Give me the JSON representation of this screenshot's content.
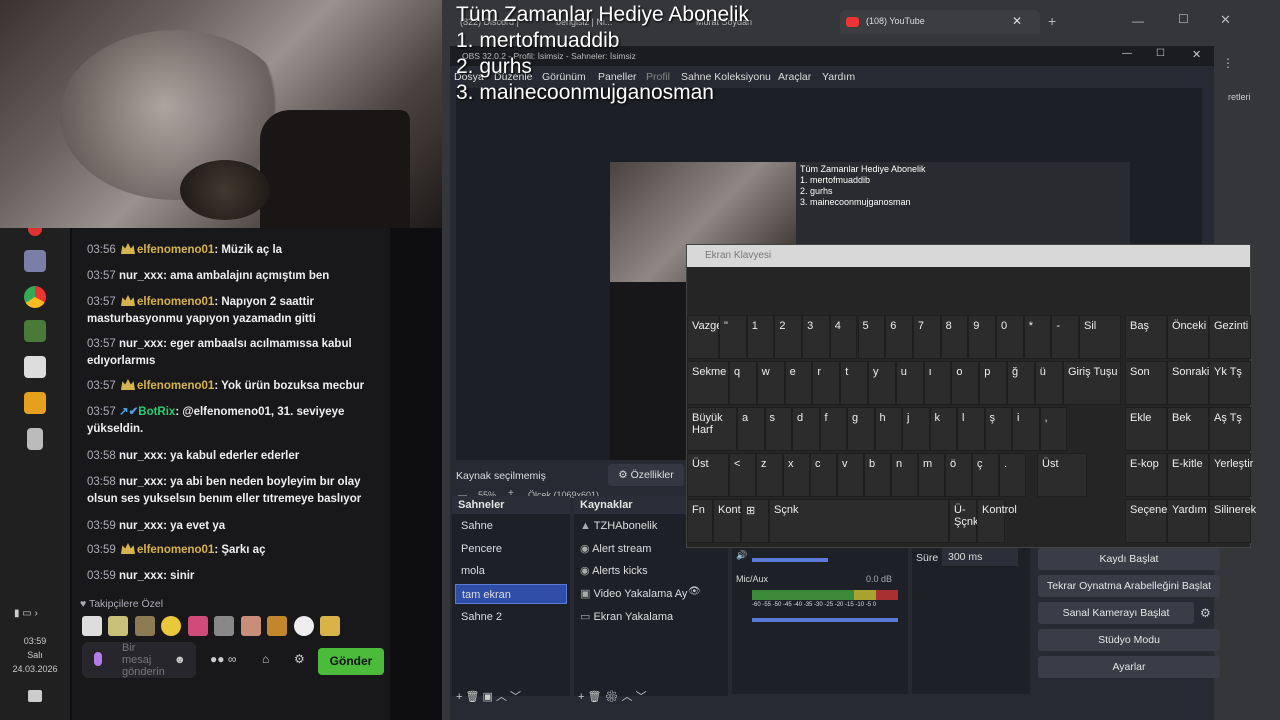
{
  "browser": {
    "tabs": [
      {
        "label": "(822) Discord | "
      },
      {
        "label": "bengisiz | Ni..."
      },
      {
        "label": "Murat Soydan"
      },
      {
        "label": "(108) YouTube"
      }
    ],
    "right_text": "retleri"
  },
  "overlay": {
    "title": "Tüm Zamanlar Hediye Abonelik",
    "line1": "1. mertofmuaddib",
    "line2": "2. gurhs",
    "line3": "3. mainecoonmujganosman"
  },
  "obs": {
    "window_title": "OBS 32.0.2 - Profil: İsimsiz - Sahneler: İsimsiz",
    "menu": [
      "Dosya",
      "Düzenle",
      "Görünüm",
      "Paneller",
      "Profil",
      "Sahne Koleksiyonu",
      "Araçlar",
      "Yardım"
    ],
    "zoom": "55%",
    "scale": "Ölçek (1069x601)",
    "no_source": "Kaynak seçilmemiş",
    "properties": "Özellikler",
    "scenes_title": "Sahneler",
    "scenes": [
      "Sahne",
      "Pencere",
      "mola",
      "tam ekran",
      "Sahne 2"
    ],
    "sources_title": "Kaynaklar",
    "sources": [
      "TZHAbonelik",
      "Alert stream",
      "Alerts kicks",
      "Video Yakalama Ay",
      "Ekran Yakalama"
    ],
    "duration_label": "Süre",
    "duration_value": "300 ms",
    "mic_label": "Mic/Aux",
    "mic_db": "0.0 dB",
    "meter_scale": "-60 -55 -50 -45 -40 -35 -30 -25 -20 -15 -10 -5 0",
    "controls": [
      "Kaydı Başlat",
      "Tekrar Oynatma Arabelleğini Başlat",
      "Sanal Kamerayı Başlat",
      "Stüdyo Modu",
      "Ayarlar"
    ]
  },
  "chat": {
    "messages": [
      {
        "time": "03:56",
        "user": "elfenomeno01",
        "text": "Müzik aç la",
        "type": "gold"
      },
      {
        "time": "03:57",
        "user": "nur_xxx",
        "text": "ama ambalajını açmıştım ben",
        "type": "plain"
      },
      {
        "time": "03:57",
        "user": "elfenomeno01",
        "text": "Napıyon 2 saattir masturbasyonmu yapıyon yazamadın gitti",
        "type": "gold"
      },
      {
        "time": "03:57",
        "user": "nur_xxx",
        "text": "eger ambaalsı acılmamıssa kabul edıyorlarmıs",
        "type": "plain"
      },
      {
        "time": "03:57",
        "user": "elfenomeno01",
        "text": "Yok ürün bozuksa mecbur",
        "type": "gold"
      },
      {
        "time": "03:57",
        "user": "BotRix",
        "text": "@elfenomeno01, 31. seviyeye yükseldin.",
        "type": "bot"
      },
      {
        "time": "03:58",
        "user": "nur_xxx",
        "text": "ya kabul ederler ederler",
        "type": "plain"
      },
      {
        "time": "03:58",
        "user": "nur_xxx",
        "text": "ya abi ben neden boyleyim bır olay olsun ses yukselsın benım eller tıtremeye baslıyor",
        "type": "plain"
      },
      {
        "time": "03:59",
        "user": "nur_xxx",
        "text": "ya evet ya",
        "type": "plain"
      },
      {
        "time": "03:59",
        "user": "elfenomeno01",
        "text": "Şarkı aç",
        "type": "gold"
      },
      {
        "time": "03:59",
        "user": "nur_xxx",
        "text": "sinir",
        "type": "plain"
      }
    ],
    "follower_label": "Takipçilere Özel",
    "input_placeholder": "Bir mesaj gönderin",
    "send": "Gönder"
  },
  "taskbar": {
    "time": "03:59",
    "day": "Salı",
    "date": "24.03.2026"
  },
  "osk": {
    "title": "Ekran Klavyesi",
    "row1": [
      "Vazgeç",
      "\"",
      "1",
      "2",
      "3",
      "4",
      "5",
      "6",
      "7",
      "8",
      "9",
      "0",
      "*",
      "-"
    ],
    "row2": [
      "Sekme",
      "q",
      "w",
      "e",
      "r",
      "t",
      "y",
      "u",
      "ı",
      "o",
      "p",
      "ğ",
      "ü",
      "Giriş Tuşu"
    ],
    "row3": [
      "Büyük Harf",
      "a",
      "s",
      "d",
      "f",
      "g",
      "h",
      "j",
      "k",
      "l",
      "ş",
      "i",
      ","
    ],
    "row4": [
      "Üst",
      "<",
      "z",
      "x",
      "c",
      "v",
      "b",
      "n",
      "m",
      "ö",
      "ç",
      ".",
      "Üst"
    ],
    "row5": [
      "Fn",
      "Kontrol",
      "⊞",
      "Sçnk",
      "Ü-Şçnk",
      "Kontrol"
    ],
    "side": [
      "Baş",
      "Önceki",
      "Gezinti",
      "Son",
      "Sonraki",
      "Yk Tş",
      "Ekle",
      "Bek",
      "Aş Tş",
      "E-kop",
      "E-kitle",
      "Yerleştir",
      "Seçenekler",
      "Yardım",
      "Silinerek"
    ],
    "del_key": "Sil"
  }
}
